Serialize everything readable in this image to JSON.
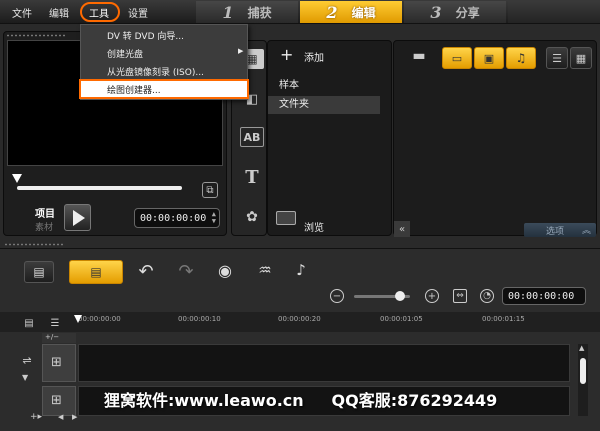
{
  "menu": {
    "file": "文件",
    "edit": "编辑",
    "tools": "工具",
    "settings": "设置"
  },
  "steps": [
    {
      "num": "1",
      "label": "捕获",
      "active": false
    },
    {
      "num": "2",
      "label": "编辑",
      "active": true
    },
    {
      "num": "3",
      "label": "分享",
      "active": false
    }
  ],
  "tools_menu": {
    "items": [
      "DV 转 DVD 向导...",
      "创建光盘",
      "从光盘镜像刻录 (ISO)...",
      "绘图创建器..."
    ],
    "highlighted_index": 3
  },
  "player": {
    "mode_project": "项目",
    "mode_clip": "素材",
    "timecode": "00:00:00:00",
    "progress": 0.0
  },
  "library": {
    "add_label": "添加",
    "folders": [
      "样本",
      "文件夹"
    ],
    "selected_folder": "文件夹",
    "browse_label": "浏览",
    "options_label": "选项"
  },
  "timeline": {
    "timecode": "00:00:00:00",
    "ruler_ticks": [
      "00:00:00:00",
      "00:00:00:10",
      "00:00:00:20",
      "00:00:01:05",
      "00:00:01:15"
    ],
    "zoom_level": 0.82
  },
  "watermark": "狸窝软件:www.leawo.cn     QQ客服:876292449",
  "colors": {
    "accent": "#f0b000",
    "highlight_ring": "#ff6a00"
  }
}
